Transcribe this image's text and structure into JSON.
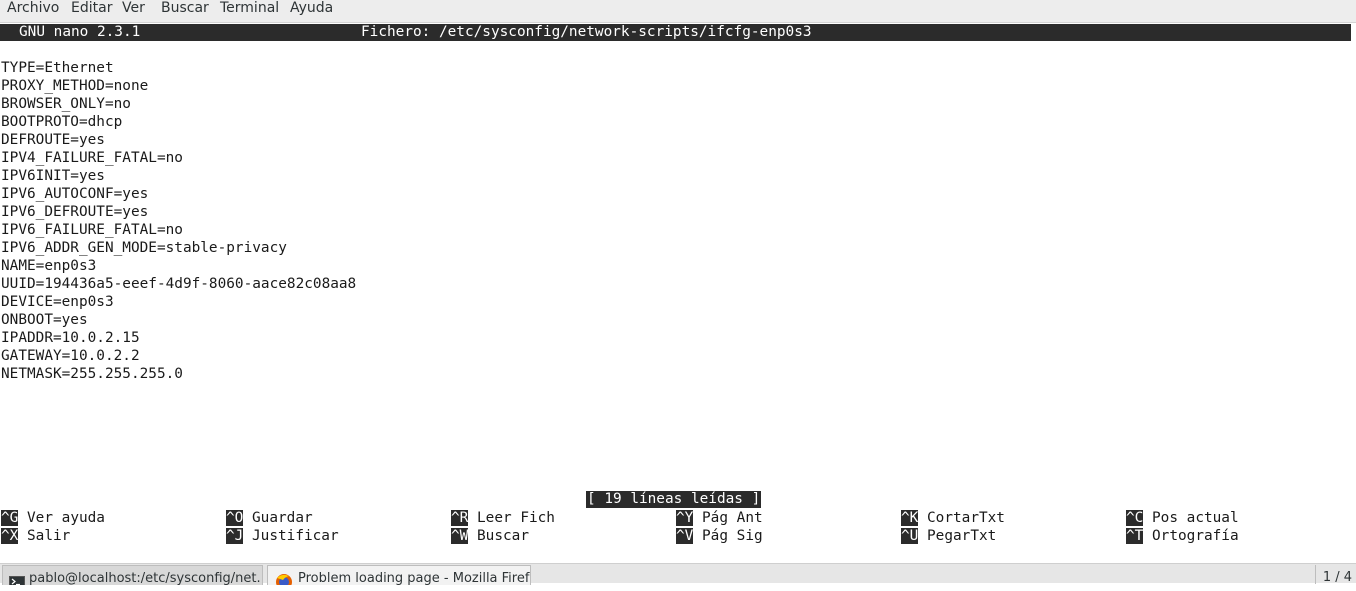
{
  "menubar": {
    "items": [
      "Archivo",
      "Editar",
      "Ver",
      "Buscar",
      "Terminal",
      "Ayuda"
    ]
  },
  "nano": {
    "version_label": "GNU nano 2.3.1",
    "file_label": "Fichero: /etc/sysconfig/network-scripts/ifcfg-enp0s3",
    "lines": [
      "TYPE=Ethernet",
      "PROXY_METHOD=none",
      "BROWSER_ONLY=no",
      "BOOTPROTO=dhcp",
      "DEFROUTE=yes",
      "IPV4_FAILURE_FATAL=no",
      "IPV6INIT=yes",
      "IPV6_AUTOCONF=yes",
      "IPV6_DEFROUTE=yes",
      "IPV6_FAILURE_FATAL=no",
      "IPV6_ADDR_GEN_MODE=stable-privacy",
      "NAME=enp0s3",
      "UUID=194436a5-eeef-4d9f-8060-aace82c08aa8",
      "DEVICE=enp0s3",
      "ONBOOT=yes",
      "IPADDR=10.0.2.15",
      "GATEWAY=10.0.2.2",
      "NETMASK=255.255.255.0"
    ],
    "status": "[ 19 líneas leídas ]",
    "shortcuts_row1": [
      {
        "key": "^G",
        "label": "Ver ayuda"
      },
      {
        "key": "^O",
        "label": "Guardar"
      },
      {
        "key": "^R",
        "label": "Leer Fich"
      },
      {
        "key": "^Y",
        "label": "Pág Ant"
      },
      {
        "key": "^K",
        "label": "CortarTxt"
      },
      {
        "key": "^C",
        "label": "Pos actual"
      }
    ],
    "shortcuts_row2": [
      {
        "key": "^X",
        "label": "Salir"
      },
      {
        "key": "^J",
        "label": "Justificar"
      },
      {
        "key": "^W",
        "label": "Buscar"
      },
      {
        "key": "^V",
        "label": "Pág Sig"
      },
      {
        "key": "^U",
        "label": "PegarTxt"
      },
      {
        "key": "^T",
        "label": "Ortografía"
      }
    ]
  },
  "taskbar": {
    "tasks": [
      {
        "label": "pablo@localhost:/etc/sysconfig/net...",
        "icon": "terminal-icon"
      },
      {
        "label": "Problem loading page - Mozilla Firefox",
        "icon": "firefox-icon"
      }
    ],
    "pager": "1 / 4"
  },
  "colors": {
    "terminal_bg": "#ffffff",
    "terminal_fg": "#1a1a1a",
    "highlight_bg": "#2b2b2b",
    "highlight_fg": "#ffffff"
  }
}
